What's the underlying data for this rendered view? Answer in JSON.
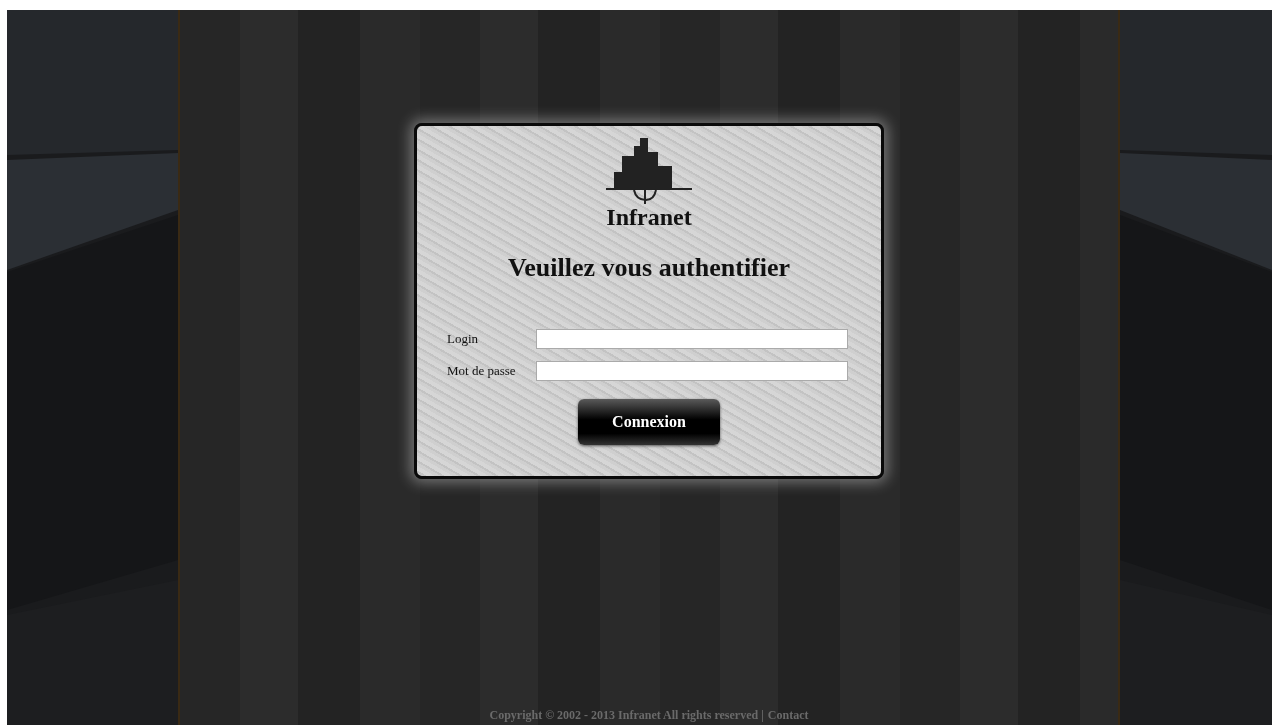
{
  "logo": {
    "name": "Infranet"
  },
  "heading": "Veuillez vous authentifier",
  "fields": [
    {
      "label": "Login"
    },
    {
      "label": "Mot de passe"
    }
  ],
  "button": "Connexion",
  "footer": {
    "copyright": "Copyright © 2002 - 2013 Infranet All rights reserved |",
    "link": "Contact"
  }
}
